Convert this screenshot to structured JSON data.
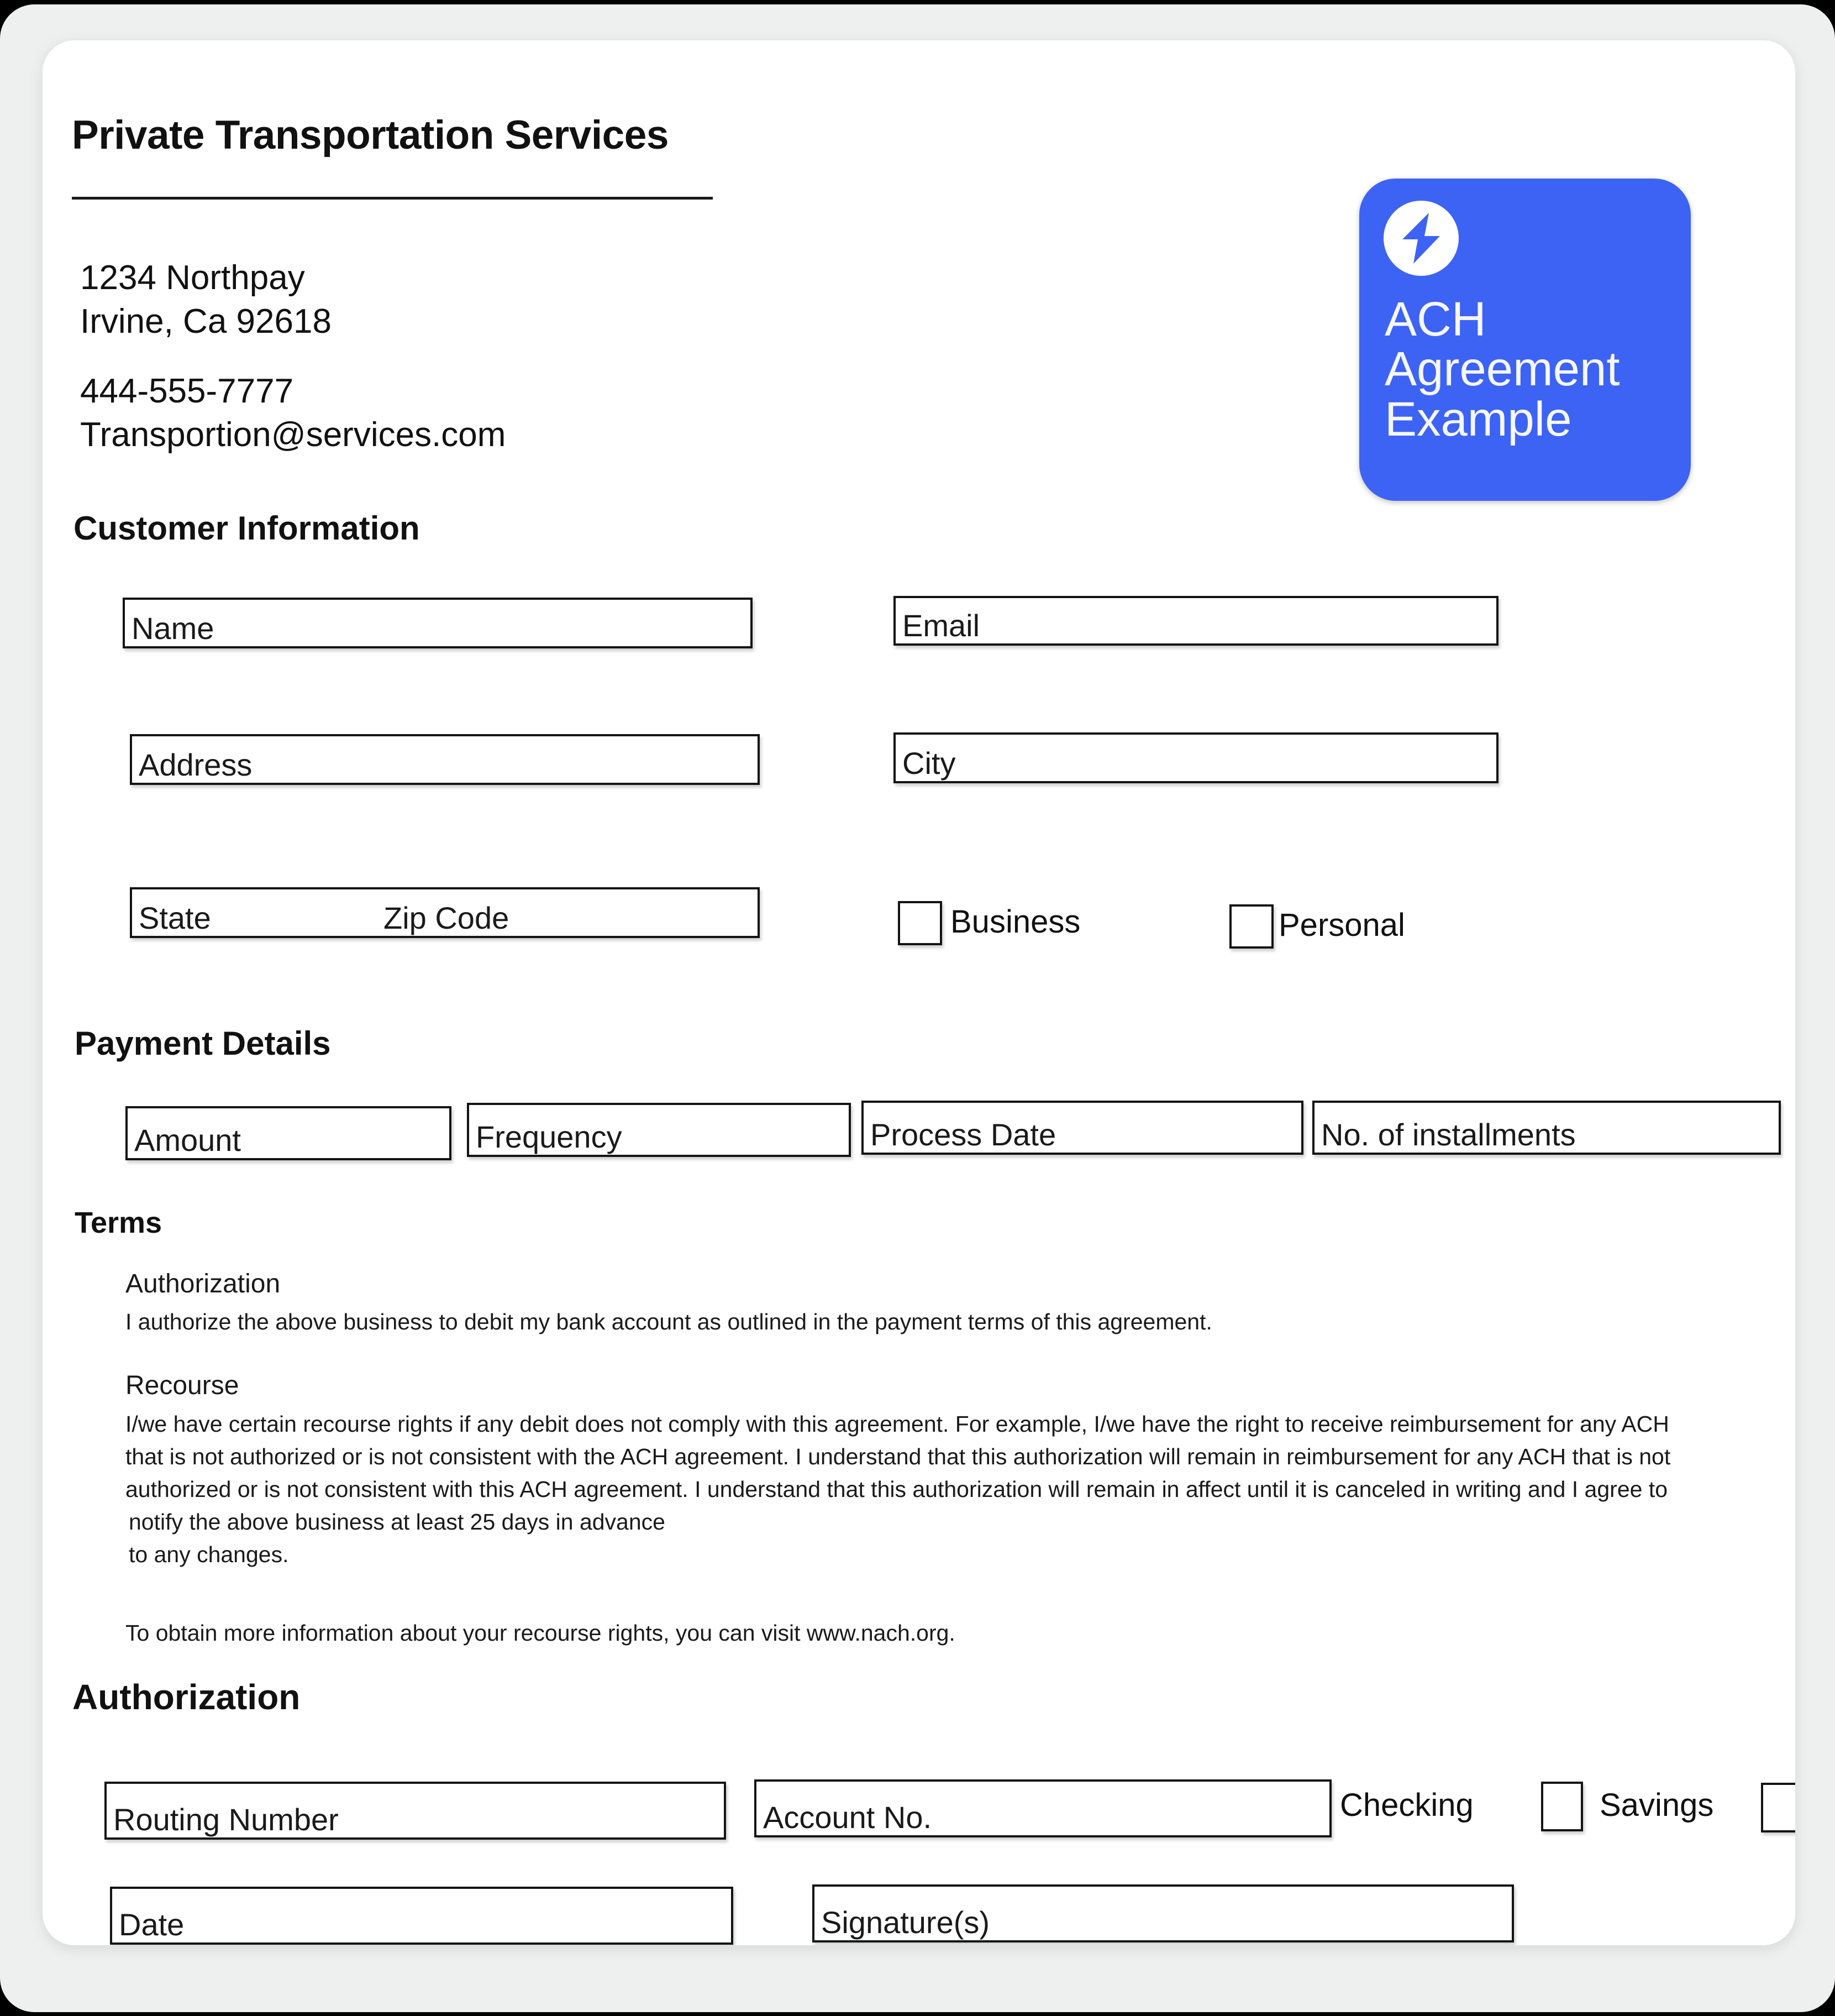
{
  "header": {
    "company_title": "Private Transportation Services",
    "address_line1": "1234 Northpay",
    "address_line2": "Irvine, Ca 92618",
    "phone": "444-555-7777",
    "email": "Transportion@services.com"
  },
  "logo": {
    "icon": "lightning-bolt-circle-icon",
    "line1": "ACH",
    "line2": "Agreement",
    "line3": "Example",
    "background_color": "#3d63f5",
    "text_color": "#f6f7fb"
  },
  "sections": {
    "customer_information": "Customer Information",
    "payment_details": "Payment Details",
    "terms": "Terms",
    "authorization": "Authorization"
  },
  "customer_fields": {
    "name": "Name",
    "email": "Email",
    "address": "Address",
    "city": "City",
    "state": "State",
    "zip_code": "Zip Code"
  },
  "account_type": {
    "business": "Business",
    "personal": "Personal"
  },
  "payment_fields": {
    "amount": "Amount",
    "frequency": "Frequency",
    "process_date": "Process Date",
    "installments": "No. of installments"
  },
  "terms": {
    "authorization_heading": "Authorization",
    "authorization_text": "I authorize the above business to debit my bank account as outlined in the payment terms of this agreement.",
    "recourse_heading": "Recourse",
    "recourse_line1": "I/we have certain recourse rights if any debit does not comply with this agreement. For example, I/we have the right to receive reimbursement for any ACH",
    "recourse_line2": "that is not authorized or is not consistent with the ACH agreement. I understand that this authorization will remain in reimbursement for any ACH that is not",
    "recourse_line3": "authorized or is not consistent with this ACH agreement. I understand that this authorization will remain in affect until it is canceled in writing and I agree to",
    "recourse_line4": "notify the above business at least 25 days in advance",
    "recourse_line5": "to any changes.",
    "more_info": "To obtain more information about your recourse rights, you can visit www.nach.org."
  },
  "authorization_fields": {
    "routing_number": "Routing Number",
    "account_no": "Account No.",
    "checking": "Checking",
    "savings": "Savings",
    "date": "Date",
    "signature": "Signature(s)"
  }
}
